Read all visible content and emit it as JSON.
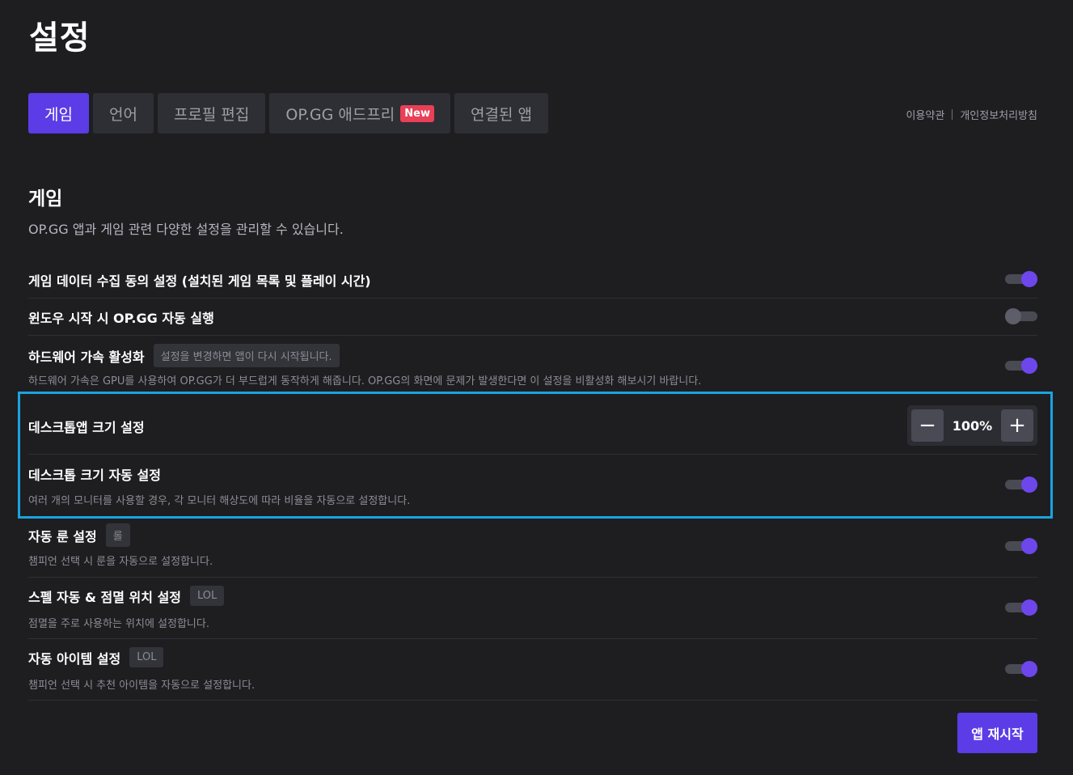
{
  "page": {
    "title": "설정"
  },
  "tabs": [
    {
      "label": "게임",
      "active": true
    },
    {
      "label": "언어"
    },
    {
      "label": "프로필 편집"
    },
    {
      "label": "OP.GG 애드프리",
      "badge": "New"
    },
    {
      "label": "연결된 앱"
    }
  ],
  "legal": {
    "terms": "이용약관",
    "privacy": "개인정보처리방침"
  },
  "section": {
    "title": "게임",
    "description": "OP.GG 앱과 게임 관련 다양한 설정을 관리할 수 있습니다."
  },
  "settings": {
    "data_consent": {
      "title": "게임 데이터 수집 동의 설정 (설치된 게임 목록 및 플레이 시간)",
      "enabled": true
    },
    "autostart": {
      "title": "윈도우 시작 시 OP.GG 자동 실행",
      "enabled": false
    },
    "hw_accel": {
      "title": "하드웨어 가속 활성화",
      "tag": "설정을 변경하면 앱이 다시 시작됩니다.",
      "description": "하드웨어 가속은 GPU를 사용하여 OP.GG가 더 부드럽게 동작하게 해줍니다. OP.GG의 화면에 문제가 발생한다면 이 설정을 비활성화 해보시기 바랍니다.",
      "enabled": true
    },
    "desktop_scale": {
      "title": "데스크톱앱 크기 설정",
      "value": "100%",
      "minus": "−",
      "plus": "+"
    },
    "auto_scale": {
      "title": "데스크톱 크기 자동 설정",
      "description": "여러 개의 모니터를 사용할 경우, 각 모니터 해상도에 따라 비율을 자동으로 설정합니다.",
      "enabled": true
    },
    "auto_rune": {
      "title": "자동 룬 설정",
      "tag": "롤",
      "description": "챔피언 선택 시 룬을 자동으로 설정합니다.",
      "enabled": true
    },
    "spell_position": {
      "title": "스펠 자동 & 점멸 위치 설정",
      "tag": "LOL",
      "description": "점멸을 주로 사용하는 위치에 설정합니다.",
      "enabled": true
    },
    "auto_item": {
      "title": "자동 아이템 설정",
      "tag": "LOL",
      "description": "챔피언 선택 시 추천 아이템을 자동으로 설정합니다.",
      "enabled": true
    }
  },
  "restart_button": {
    "label": "앱 재시작"
  },
  "colors": {
    "accent": "#5b3ce6",
    "toggle_on": "#6d47eb",
    "highlight": "#1aa3e0",
    "badge_new": "#e84057"
  }
}
